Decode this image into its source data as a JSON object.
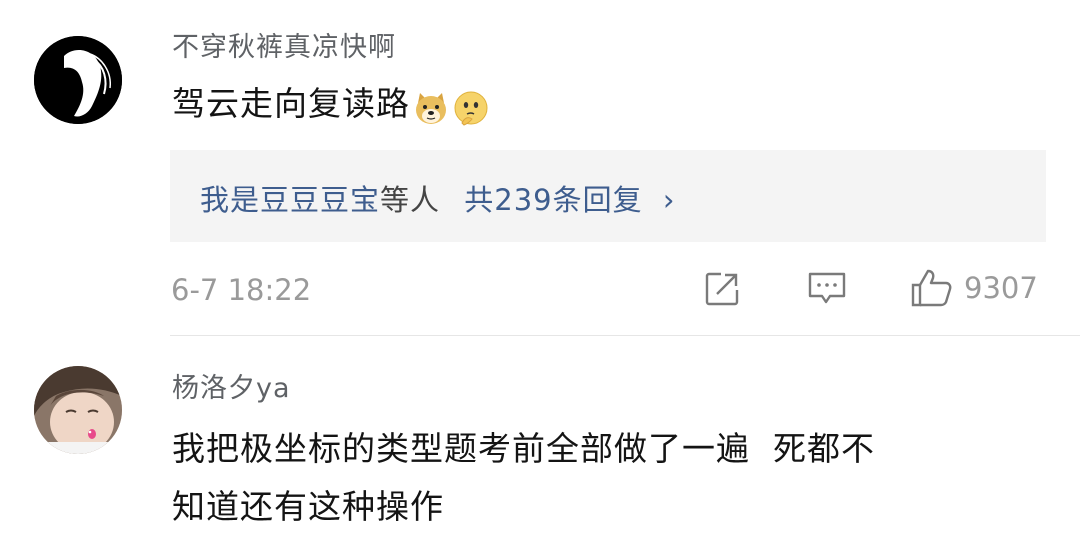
{
  "comments": [
    {
      "username": "不穿秋裤真凉快啊",
      "text": "驾云走向复读路",
      "emojis": [
        "doge-emoji",
        "thinking-emoji"
      ],
      "reply_preview": {
        "names": "我是豆豆豆宝",
        "suffix": "等人",
        "count_text": "共239条回复",
        "chevron": "›"
      },
      "time": "6-7 18:22",
      "likes": "9307"
    },
    {
      "username": "杨洛夕ya",
      "text_line1": "我把极坐标的类型题考前全部做了一遍  死都不",
      "text_line2": "知道还有这种操作"
    }
  ],
  "colors": {
    "link": "#3e5d8e",
    "meta": "#9a9a9a",
    "username": "#5f6266"
  },
  "icons": [
    "share-icon",
    "comment-icon",
    "thumbs-up-icon"
  ]
}
